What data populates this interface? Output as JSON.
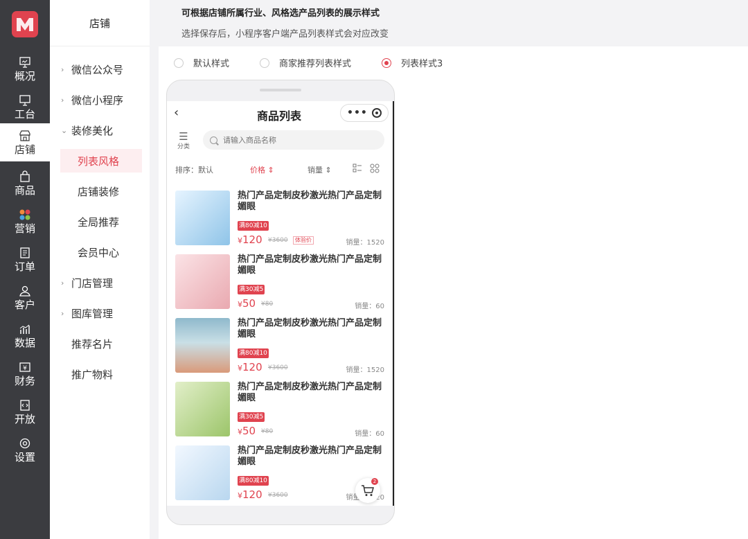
{
  "rail": {
    "items": [
      {
        "label": "概况",
        "icon": "monitor-icon"
      },
      {
        "label": "工台",
        "icon": "desktop-icon"
      },
      {
        "label": "店铺",
        "icon": "store-icon",
        "active": true
      },
      {
        "label": "商品",
        "icon": "bag-icon"
      },
      {
        "label": "营销",
        "icon": "marketing-grid-icon"
      },
      {
        "label": "订单",
        "icon": "order-icon"
      },
      {
        "label": "客户",
        "icon": "user-icon"
      },
      {
        "label": "数据",
        "icon": "chart-icon"
      },
      {
        "label": "财务",
        "icon": "finance-icon"
      },
      {
        "label": "开放",
        "icon": "code-icon"
      },
      {
        "label": "设置",
        "icon": "settings-icon"
      }
    ]
  },
  "submenu": {
    "title": "店铺",
    "items": [
      {
        "label": "微信公众号"
      },
      {
        "label": "微信小程序"
      },
      {
        "label": "装修美化"
      },
      {
        "label": "列表风格"
      },
      {
        "label": "店铺装修"
      },
      {
        "label": "全局推荐"
      },
      {
        "label": "会员中心"
      },
      {
        "label": "门店管理"
      },
      {
        "label": "图库管理"
      },
      {
        "label": "推荐名片"
      },
      {
        "label": "推广物料"
      }
    ]
  },
  "notice": {
    "title": "可根据店铺所属行业、风格选产品列表的展示样式",
    "desc": "选择保存后，小程序客户端产品列表样式会对应改变"
  },
  "styles": {
    "options": [
      "默认样式",
      "商家推荐列表样式",
      "列表样式3"
    ],
    "selected": "列表样式3"
  },
  "phone": {
    "nav_title": "商品列表",
    "back_symbol": "‹",
    "menu_dots": "•••",
    "category_label": "分类",
    "search_placeholder": "请输入商品名称",
    "sort_label": "排序：默认",
    "sort_price": "价格 ⇕",
    "sort_sales": "销量 ⇕",
    "cart_badge": "2",
    "products": [
      {
        "name": "热门产品定制皮秒激光热门产品定制媚眼",
        "coupon": "满80减10",
        "yen": "¥",
        "price": "120",
        "old": "¥3600",
        "tag": "体验价",
        "sales": "销量：1520",
        "colors": [
          "#dcefff",
          "#8fc4e8"
        ]
      },
      {
        "name": "热门产品定制皮秒激光热门产品定制媚眼",
        "coupon": "满30减5",
        "yen": "¥",
        "price": "50",
        "old": "¥80",
        "tag": "",
        "sales": "销量：60",
        "colors": [
          "#fbe3e6",
          "#e9a9b0"
        ]
      },
      {
        "name": "热门产品定制皮秒激光热门产品定制媚眼",
        "coupon": "满80减10",
        "yen": "¥",
        "price": "120",
        "old": "¥3600",
        "tag": "",
        "sales": "销量：1520",
        "colors": [
          "#8fb9cc",
          "#d99a7a"
        ]
      },
      {
        "name": "热门产品定制皮秒激光热门产品定制媚眼",
        "coupon": "满30减5",
        "yen": "¥",
        "price": "50",
        "old": "¥80",
        "tag": "",
        "sales": "销量：60",
        "colors": [
          "#e2efc9",
          "#9cc56a"
        ]
      },
      {
        "name": "热门产品定制皮秒激光热门产品定制媚眼",
        "coupon": "满80减10",
        "yen": "¥",
        "price": "120",
        "old": "¥3600",
        "tag": "",
        "sales": "销量：1520",
        "colors": [
          "#f2f8ff",
          "#b9d7ef"
        ]
      }
    ]
  },
  "theme": {
    "accent": "#e0434f",
    "rail_bg": "#3b3c40"
  }
}
